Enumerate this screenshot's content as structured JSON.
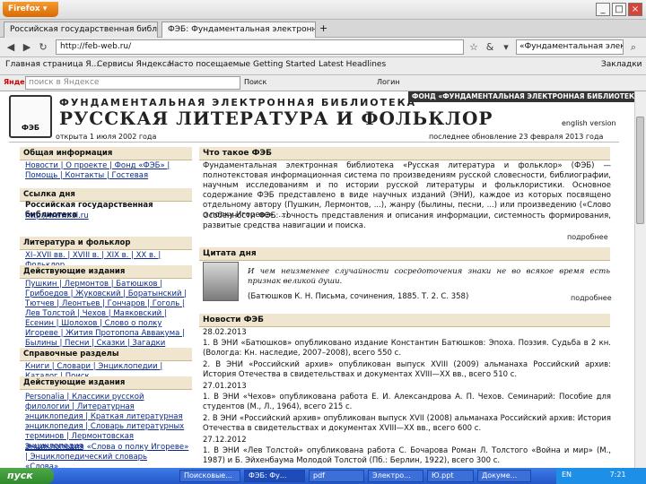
{
  "window": {
    "app": "Firefox"
  },
  "tabs": [
    {
      "label": "Российская государственная библиот...",
      "active": false
    },
    {
      "label": "ФЭБ: Фундаментальная электронная б...",
      "active": true
    }
  ],
  "nav": {
    "url": "http://feb-web.ru/",
    "search": "«Фундаментальная электронная библиотека»"
  },
  "bookmarks": [
    "Главная страница Я...",
    "Сервисы Яндекса",
    "Часто посещаемые",
    "Getting Started",
    "Latest Headlines",
    "Закладки"
  ],
  "yandex": {
    "brand": "Яндекс",
    "placeholder": "поиск в Яндексе",
    "search_btn": "Поиск",
    "login": "Логин"
  },
  "site": {
    "title1": "ФУНДАМЕНТАЛЬНАЯ ЭЛЕКТРОННАЯ БИБЛИОТЕКА",
    "title2": "РУССКАЯ ЛИТЕРАТУРА И ФОЛЬКЛОР",
    "fond": "ФОНД «ФУНДАМЕНТАЛЬНАЯ ЭЛЕКТРОННАЯ БИБЛИОТЕКА»",
    "logo_text": "ФЭБ",
    "opened": "открыта 1 июля 2002 года",
    "updated": "последнее обновление 23 февраля 2013 года",
    "english": "english version"
  },
  "sidebar": {
    "general_head": "Общая информация",
    "general_links": "Новости | О проекте | Фонд «ФЭБ» | Помощь | Контакты | Гостевая",
    "link_day_head": "Ссылка дня",
    "link_day_name": "Российская государственная библиотека",
    "link_day_url": "http://www.rsl.ru",
    "lit_head": "Литература и фольклор",
    "lit_links": "XI–XVII вв. | XVIII в. | XIX в. | XX в. | Фольклор",
    "editions_head": "Действующие издания",
    "editions": "Пушкин | Лермонтов | Батюшков | Грибоедов | Жуковский | Боратынский | Тютчев | Леонтьев | Гончаров | Гоголь | Лев Толстой | Чехов | Маяковский | Есенин | Шолохов | Слово о полку Игореве | Жития Протопопа Аввакума | Былины | Песни | Сказки | Загадки",
    "ref_head": "Справочные разделы",
    "ref_links": "Книги | Словари | Энциклопедии | Каталог | Поиск",
    "editions2_head": "Действующие издания",
    "editions2": "Personalia | Классики русской филологии | Литературная энциклопедия | Краткая литературная энциклопедия | Словарь литературных терминов | Лермонтовская энциклопедия",
    "editions2b": "Энциклопедия «Слова о полку Игореве» | Энциклопедический словарь «Слова»..."
  },
  "main": {
    "what_head": "Что такое ФЭБ",
    "what_text": "Фундаментальная электронная библиотека «Русская литература и фольклор» (ФЭБ) — полнотекстовая информационная система по произведениям русской словесности, библиографии, научным исследованиям и по истории русской литературы и фольклористики. Основное содержание ФЭБ представлено в виде научных изданий (ЭНИ), каждое из которых посвящено отдельному автору (Пушкин, Лермонтов, ...), жанру (былины, песни, ...) или произведению («Слово о полку Игореве», ...).",
    "what_text2": "Особенности ФЭБ: точность представления и описания информации, системность формирования, развитые средства навигации и поиска.",
    "more": "подробнее",
    "quote_head": "Цитата дня",
    "quote_text": "И чем неизменнее случайности сосредоточения знаки не во всякое время есть признак великой души.",
    "quote_src": "(Батюшков К. Н. Письма, сочинения, 1885. Т. 2. С. 358)",
    "news_head": "Новости ФЭБ",
    "news_date1": "28.02.2013",
    "news1": "1. В ЭНИ «Батюшков» опубликовано издание Константин Батюшков: Эпоха. Поэзия. Судьба в 2 кн. (Вологда: Кн. наследие, 2007–2008), всего 550 с.",
    "news2": "2. В ЭНИ «Российский архив» опубликован выпуск XVIII (2009) альманаха Российский архив: История Отечества в свидетельствах и документах XVIII—XX вв., всего 510 с.",
    "news_date2": "27.01.2013",
    "news3": "1. В ЭНИ «Чехов» опубликована работа Е. И. Александрова А. П. Чехов. Семинарий: Пособие для студентов (М., Л., 1964), всего 215 с.",
    "news4": "2. В ЭНИ «Российский архив» опубликован выпуск XVII (2008) альманаха Российский архив: История Отечества в свидетельствах и документах XVIII—XX вв., всего 600 с.",
    "news_date3": "27.12.2012",
    "news5": "1. В ЭНИ «Лев Толстой» опубликована работа С. Бочарова Роман Л. Толстого «Война и мир» (М., 1987) и Б. Эйхенбаума Молодой Толстой (Пб.: Берлин, 1922), всего 300 с."
  },
  "taskbar": {
    "start": "пуск",
    "items": [
      "Поисковые...",
      "ФЭБ: Фу...",
      "pdf",
      "Электро...",
      "Ю.ppt",
      "Докуме..."
    ],
    "lang": "EN",
    "time": "7:21"
  }
}
